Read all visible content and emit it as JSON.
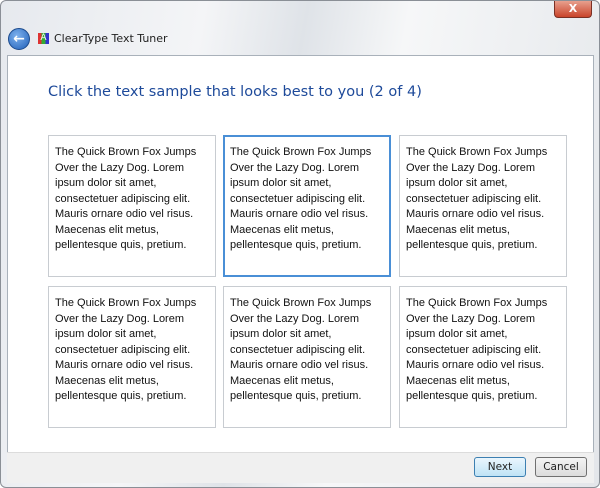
{
  "window": {
    "title": "ClearType Text Tuner",
    "close_label": "X"
  },
  "heading": "Click the text sample that looks best to you (2 of 4)",
  "samples": [
    {
      "text": "The Quick Brown Fox Jumps Over the Lazy Dog. Lorem ipsum dolor sit amet, consectetuer adipiscing elit. Mauris ornare odio vel risus. Maecenas elit metus, pellentesque quis, pretium."
    },
    {
      "text": "The Quick Brown Fox Jumps Over the Lazy Dog. Lorem ipsum dolor sit amet, consectetuer adipiscing elit. Mauris ornare odio vel risus. Maecenas elit metus, pellentesque quis, pretium.",
      "selected": true
    },
    {
      "text": "The Quick Brown Fox Jumps Over the Lazy Dog. Lorem ipsum dolor sit amet, consectetuer adipiscing elit. Mauris ornare odio vel risus. Maecenas elit metus, pellentesque quis, pretium."
    },
    {
      "text": "The Quick Brown Fox Jumps Over the Lazy Dog. Lorem ipsum dolor sit amet, consectetuer adipiscing elit. Mauris ornare odio vel risus. Maecenas elit metus, pellentesque quis, pretium."
    },
    {
      "text": "The Quick Brown Fox Jumps Over the Lazy Dog. Lorem ipsum dolor sit amet, consectetuer adipiscing elit. Mauris ornare odio vel risus. Maecenas elit metus, pellentesque quis, pretium."
    },
    {
      "text": "The Quick Brown Fox Jumps Over the Lazy Dog. Lorem ipsum dolor sit amet, consectetuer adipiscing elit. Mauris ornare odio vel risus. Maecenas elit metus, pellentesque quis, pretium."
    }
  ],
  "buttons": {
    "next": "Next",
    "cancel": "Cancel"
  },
  "colors": {
    "accent": "#4a8fd6",
    "heading": "#1e4a9a"
  }
}
